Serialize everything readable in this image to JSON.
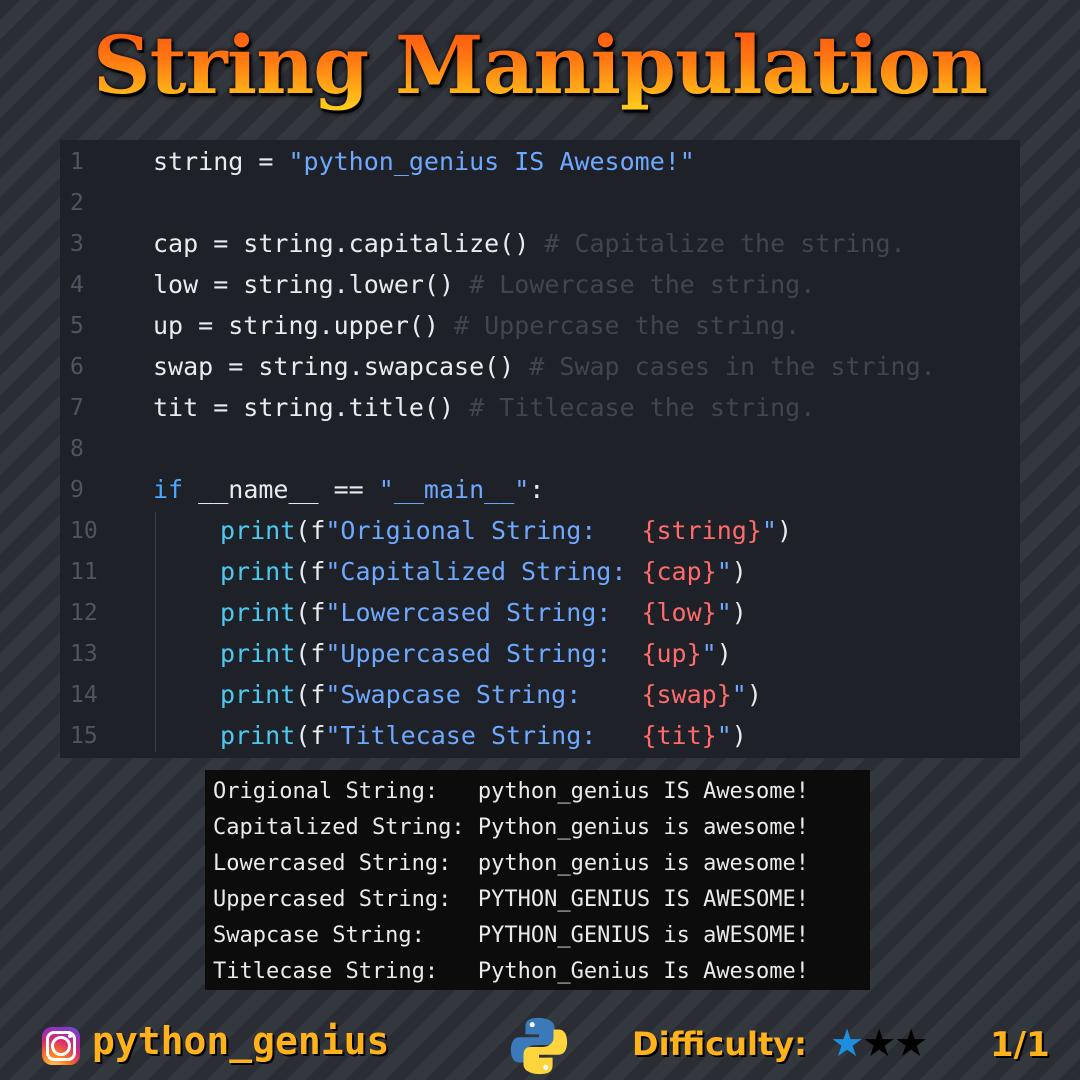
{
  "title": "String Manipulation",
  "editor": {
    "lines": [
      {
        "n": "1",
        "segs": [
          {
            "t": "string = ",
            "c": ""
          },
          {
            "t": "\"python_genius IS Awesome!\"",
            "c": "str"
          }
        ]
      },
      {
        "n": "2",
        "segs": []
      },
      {
        "n": "3",
        "segs": [
          {
            "t": "cap = string.capitalize() ",
            "c": ""
          },
          {
            "t": "# Capitalize the string.",
            "c": "com"
          }
        ]
      },
      {
        "n": "4",
        "segs": [
          {
            "t": "low = string.lower() ",
            "c": ""
          },
          {
            "t": "# Lowercase the string.",
            "c": "com"
          }
        ]
      },
      {
        "n": "5",
        "segs": [
          {
            "t": "up = string.upper() ",
            "c": ""
          },
          {
            "t": "# Uppercase the string.",
            "c": "com"
          }
        ]
      },
      {
        "n": "6",
        "segs": [
          {
            "t": "swap = string.swapcase() ",
            "c": ""
          },
          {
            "t": "# Swap cases in the string.",
            "c": "com"
          }
        ]
      },
      {
        "n": "7",
        "segs": [
          {
            "t": "tit = string.title() ",
            "c": ""
          },
          {
            "t": "# Titlecase the string.",
            "c": "com"
          }
        ]
      },
      {
        "n": "8",
        "segs": []
      },
      {
        "n": "9",
        "segs": [
          {
            "t": "if",
            "c": "kw"
          },
          {
            "t": " __name__ == ",
            "c": ""
          },
          {
            "t": "\"__main__\"",
            "c": "str"
          },
          {
            "t": ":",
            "c": ""
          }
        ]
      },
      {
        "n": "10",
        "ind": true,
        "segs": [
          {
            "t": "print",
            "c": "fn"
          },
          {
            "t": "(f",
            "c": ""
          },
          {
            "t": "\"Origional String:   ",
            "c": "str"
          },
          {
            "t": "{string}",
            "c": "brace"
          },
          {
            "t": "\"",
            "c": "str"
          },
          {
            "t": ")",
            "c": ""
          }
        ]
      },
      {
        "n": "11",
        "ind": true,
        "segs": [
          {
            "t": "print",
            "c": "fn"
          },
          {
            "t": "(f",
            "c": ""
          },
          {
            "t": "\"Capitalized String: ",
            "c": "str"
          },
          {
            "t": "{cap}",
            "c": "brace"
          },
          {
            "t": "\"",
            "c": "str"
          },
          {
            "t": ")",
            "c": ""
          }
        ]
      },
      {
        "n": "12",
        "ind": true,
        "segs": [
          {
            "t": "print",
            "c": "fn"
          },
          {
            "t": "(f",
            "c": ""
          },
          {
            "t": "\"Lowercased String:  ",
            "c": "str"
          },
          {
            "t": "{low}",
            "c": "brace"
          },
          {
            "t": "\"",
            "c": "str"
          },
          {
            "t": ")",
            "c": ""
          }
        ]
      },
      {
        "n": "13",
        "ind": true,
        "segs": [
          {
            "t": "print",
            "c": "fn"
          },
          {
            "t": "(f",
            "c": ""
          },
          {
            "t": "\"Uppercased String:  ",
            "c": "str"
          },
          {
            "t": "{up}",
            "c": "brace"
          },
          {
            "t": "\"",
            "c": "str"
          },
          {
            "t": ")",
            "c": ""
          }
        ]
      },
      {
        "n": "14",
        "ind": true,
        "segs": [
          {
            "t": "print",
            "c": "fn"
          },
          {
            "t": "(f",
            "c": ""
          },
          {
            "t": "\"Swapcase String:    ",
            "c": "str"
          },
          {
            "t": "{swap}",
            "c": "brace"
          },
          {
            "t": "\"",
            "c": "str"
          },
          {
            "t": ")",
            "c": ""
          }
        ]
      },
      {
        "n": "15",
        "ind": true,
        "segs": [
          {
            "t": "print",
            "c": "fn"
          },
          {
            "t": "(f",
            "c": ""
          },
          {
            "t": "\"Titlecase String:   ",
            "c": "str"
          },
          {
            "t": "{tit}",
            "c": "brace"
          },
          {
            "t": "\"",
            "c": "str"
          },
          {
            "t": ")",
            "c": ""
          }
        ]
      }
    ]
  },
  "output": {
    "lines": [
      "Origional String:   python_genius IS Awesome!",
      "Capitalized String: Python_genius is awesome!",
      "Lowercased String:  python_genius is awesome!",
      "Uppercased String:  PYTHON_GENIUS IS AWESOME!",
      "Swapcase String:    PYTHON_GENIUS is aWESOME!",
      "Titlecase String:   Python_Genius Is Awesome!"
    ]
  },
  "footer": {
    "handle": "python_genius",
    "difficulty_label": "Difficulty:",
    "difficulty": {
      "filled": 1,
      "total": 3
    },
    "page": "1/1",
    "icons": [
      "instagram-icon",
      "python-logo-icon",
      "star-icon"
    ]
  },
  "colors": {
    "accent": "#ffb21a",
    "title_gradient": [
      "#ff4a10",
      "#ffd21c"
    ],
    "editor_bg": "#1e2127",
    "terminal_bg": "#0c0c0c",
    "star_filled": "#1e8fe0"
  }
}
